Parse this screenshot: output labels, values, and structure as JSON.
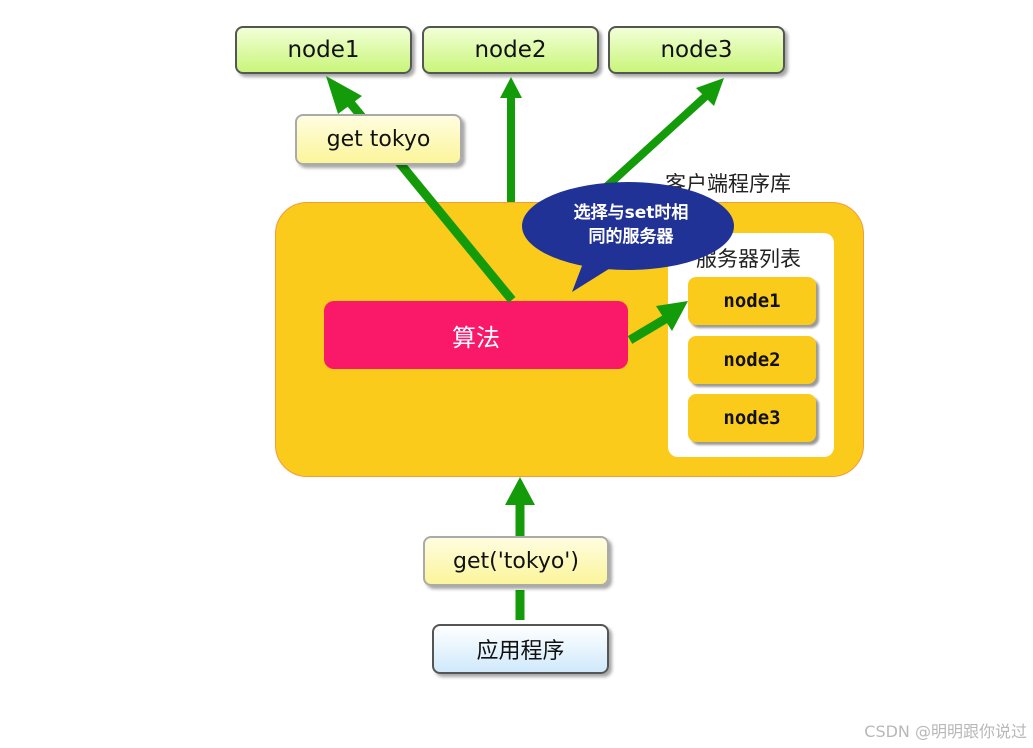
{
  "top_nodes": [
    {
      "label": "node1"
    },
    {
      "label": "node2"
    },
    {
      "label": "node3"
    }
  ],
  "get_label": "get tokyo",
  "client_library": {
    "title": "客户端程序库",
    "algorithm": "算法",
    "speech_bubble": {
      "line1": "选择与set时相",
      "line2": "同的服务器"
    },
    "server_list": {
      "title": "服务器列表",
      "nodes": [
        "node1",
        "node2",
        "node3"
      ]
    }
  },
  "call_label": "get('tokyo')",
  "application": "应用程序",
  "watermark": "CSDN @明明跟你说过",
  "colors": {
    "arrow": "#149b0a",
    "client_box": "#fbcb1c",
    "client_border": "#f39a3c",
    "algorithm": "#fa1868",
    "bubble": "#213296",
    "top_node_fill": "#d6f98e",
    "label_fill": "#fbf7a8",
    "app_fill": "#dff0fc"
  }
}
